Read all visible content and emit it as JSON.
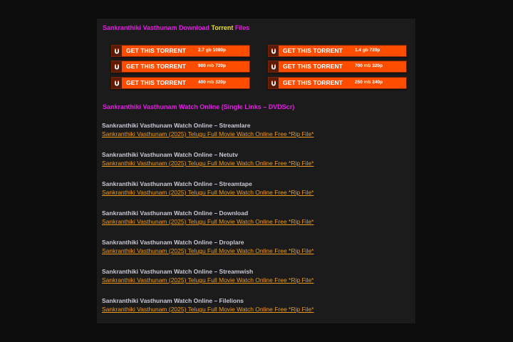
{
  "download_heading": {
    "part1": "Sankranthiki Vasthunam Download",
    "part2": "Torrent",
    "part3": "Files"
  },
  "torrent_buttons": [
    {
      "label": "GET THIS TORRENT",
      "size": "2.7 gb 1080p"
    },
    {
      "label": "GET THIS TORRENT",
      "size": "1.4 gb 720p"
    },
    {
      "label": "GET THIS TORRENT",
      "size": "900 mb 720p"
    },
    {
      "label": "GET THIS TORRENT",
      "size": "700 mb 320p"
    },
    {
      "label": "GET THIS TORRENT",
      "size": "400 mb 320p"
    },
    {
      "label": "GET THIS TORRENT",
      "size": "250 mb 240p"
    }
  ],
  "watch_heading": "Sankranthiki Vasthunam Watch Online (Single Links – DVDScr)",
  "watch_links": [
    {
      "title": "Sankranthiki Vasthunam Watch Online – Streamlare",
      "link": "Sankranthiki Vasthunam (2025) Telugu Full Movie Watch Online Free *Rip File*"
    },
    {
      "title": "Sankranthiki Vasthunam Watch Online – Netutv",
      "link": "Sankranthiki Vasthunam (2025) Telugu Full Movie Watch Online Free *Rip File*"
    },
    {
      "title": "Sankranthiki Vasthunam Watch Online – Streamtape",
      "link": "Sankranthiki Vasthunam (2025) Telugu Full Movie Watch Online Free *Rip File*"
    },
    {
      "title": "Sankranthiki Vasthunam Watch Online – Download",
      "link": "Sankranthiki Vasthunam (2025) Telugu Full Movie Watch Online Free *Rip File*"
    },
    {
      "title": "Sankranthiki Vasthunam Watch Online – Droplare",
      "link": "Sankranthiki Vasthunam (2025) Telugu Full Movie Watch Online Free *Rip File*"
    },
    {
      "title": "Sankranthiki Vasthunam Watch Online – Streamwish",
      "link": "Sankranthiki Vasthunam (2025) Telugu Full Movie Watch Online Free *Rip File*"
    },
    {
      "title": "Sankranthiki Vasthunam Watch Online – Filelions",
      "link": "Sankranthiki Vasthunam (2025) Telugu Full Movie Watch Online Free *Rip File*"
    }
  ],
  "colors": {
    "heading": "#e61ee6",
    "highlight": "#f0e21e",
    "button": "#ff4d00",
    "link": "#f09a1a"
  },
  "icons": {
    "button_icon": "magnet-icon"
  }
}
